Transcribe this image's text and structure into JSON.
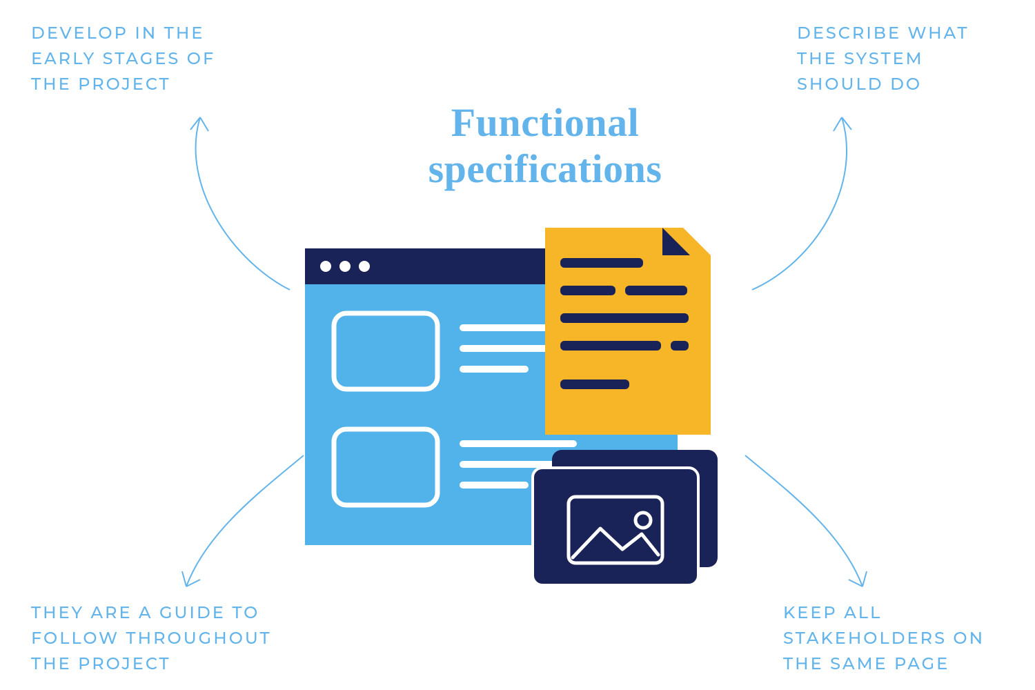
{
  "title_line1": "Functional",
  "title_line2": "specifications",
  "callouts": {
    "top_left": "DEVELOP IN THE EARLY STAGES OF THE PROJECT",
    "top_right": "DESCRIBE WHAT THE SYSTEM SHOULD DO",
    "bottom_left": "THEY ARE A GUIDE TO FOLLOW THROUGHOUT THE PROJECT",
    "bottom_right": "KEEP ALL STAKEHOLDERS ON THE SAME PAGE"
  },
  "colors": {
    "accent": "#62b4eb",
    "navy": "#1a2357",
    "gold": "#f7b528",
    "white": "#ffffff"
  }
}
